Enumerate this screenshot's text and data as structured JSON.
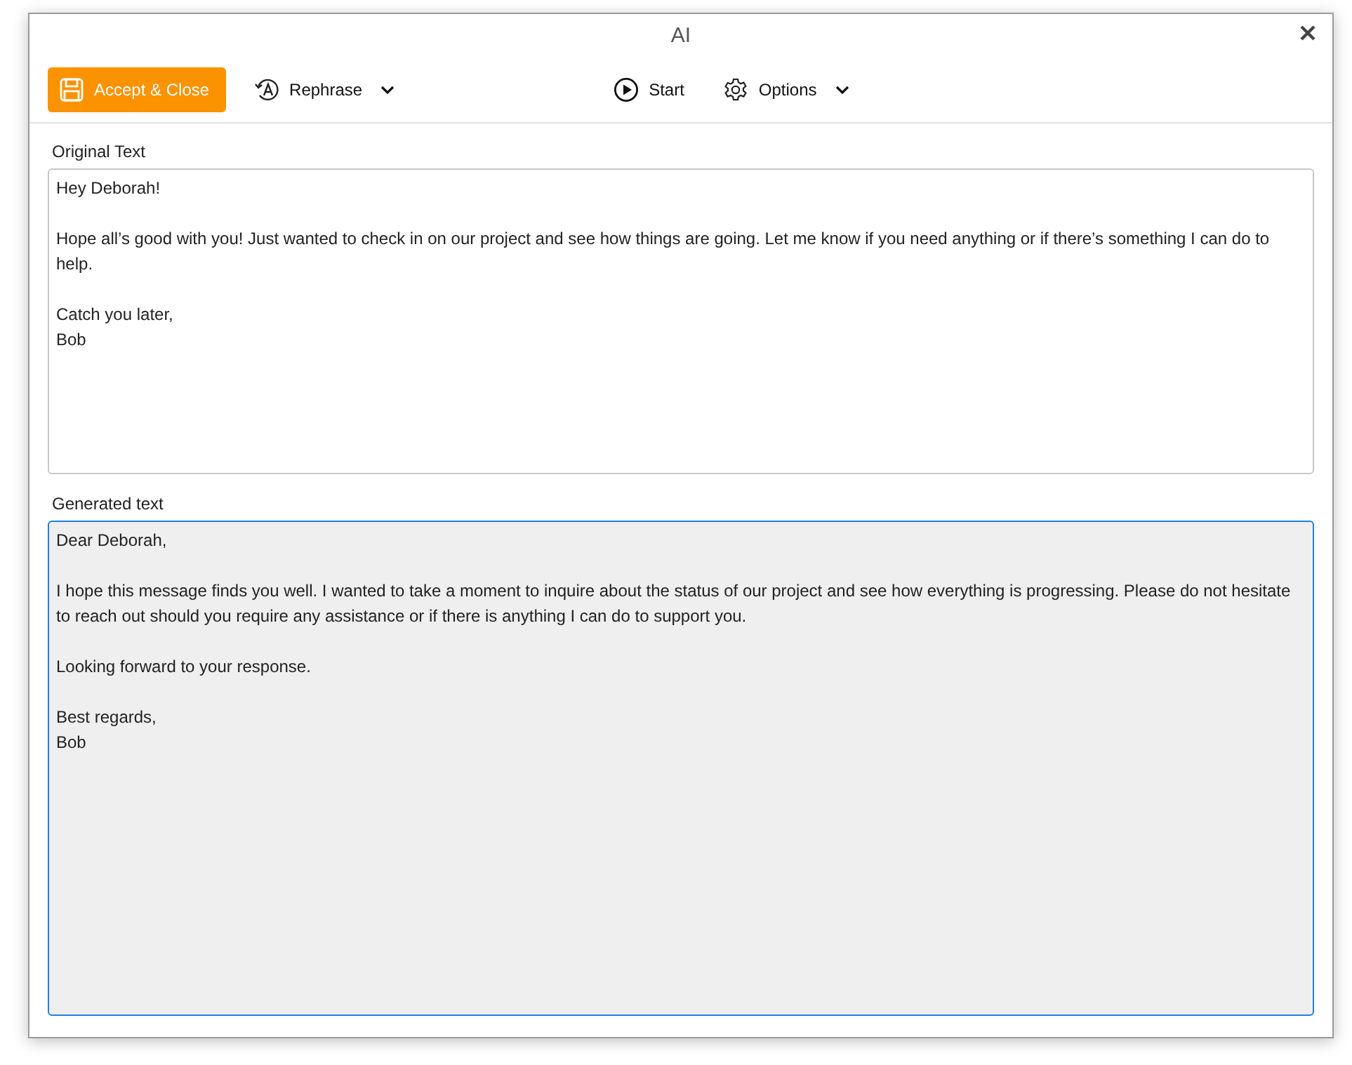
{
  "window": {
    "title": "AI"
  },
  "toolbar": {
    "items": [
      {
        "kind": "primary",
        "label": "Accept & Close",
        "dropdown": false
      },
      {
        "kind": "plain",
        "label": "Rephrase",
        "dropdown": true
      },
      {
        "kind": "spacer"
      },
      {
        "kind": "plain",
        "label": "Start",
        "dropdown": false
      },
      {
        "kind": "plain",
        "label": "Options",
        "dropdown": true
      }
    ]
  },
  "original": {
    "label": "Original Text",
    "paragraphs": [
      "Hey Deborah!",
      "Hope all’s good with you! Just wanted to check in on our project and see how things are going. Let me know if you need anything or if there’s something I can do to help.",
      [
        "Catch you later,",
        "Bob"
      ]
    ]
  },
  "generated": {
    "label": "Generated text",
    "focused": true,
    "paragraphs": [
      "Dear Deborah,",
      "I hope this message finds you well. I wanted to take a moment to inquire about the status of our project and see how everything is progressing. Please do not hesitate to reach out should you require any assistance or if there is anything I can do to support you.",
      "Looking forward to your response.",
      [
        "Best regards,",
        "Bob"
      ]
    ]
  }
}
